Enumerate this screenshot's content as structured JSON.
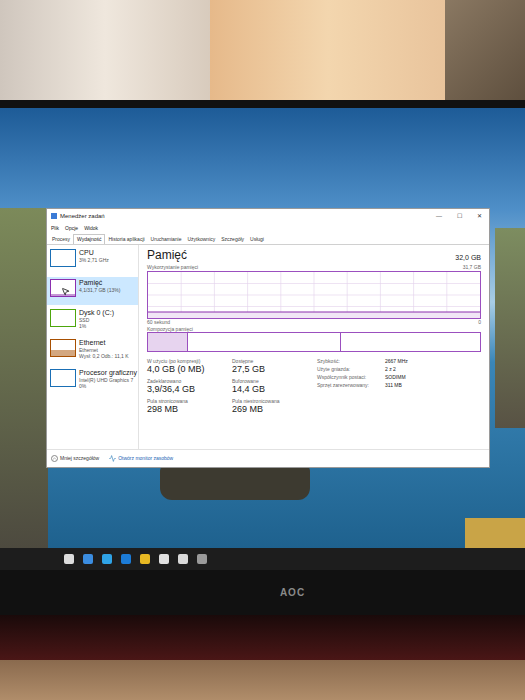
{
  "window": {
    "title": "Menedżer zadań",
    "controls": [
      "—",
      "☐",
      "✕"
    ]
  },
  "menu": [
    "Plik",
    "Opcje",
    "Widok"
  ],
  "tabs": [
    {
      "label": "Procesy",
      "selected": false
    },
    {
      "label": "Wydajność",
      "selected": true
    },
    {
      "label": "Historia aplikacji",
      "selected": false
    },
    {
      "label": "Uruchamianie",
      "selected": false
    },
    {
      "label": "Użytkownicy",
      "selected": false
    },
    {
      "label": "Szczegóły",
      "selected": false
    },
    {
      "label": "Usługi",
      "selected": false
    }
  ],
  "sidebar": {
    "items": [
      {
        "name": "CPU",
        "details": [
          "3% 2,71 GHz"
        ],
        "level": 0.03,
        "color": "#1a6fb5",
        "selected": false
      },
      {
        "name": "Pamięć",
        "details": [
          "4,1/31,7 GB (13%)"
        ],
        "level": 0.13,
        "color": "#8b2fae",
        "selected": true
      },
      {
        "name": "Dysk 0 (C:)",
        "details": [
          "SSD",
          "1%"
        ],
        "level": 0.01,
        "color": "#4da60c",
        "selected": false
      },
      {
        "name": "Ethernet",
        "details": [
          "Ethernet",
          "Wysł: 0,2 Odb.: 11,1 K"
        ],
        "level": 0.35,
        "color": "#a74f01",
        "selected": false
      },
      {
        "name": "Procesor graficzny",
        "details": [
          "Intel(R) UHD Graphics 7",
          "0%"
        ],
        "level": 0,
        "color": "#1a6fb5",
        "selected": false
      }
    ]
  },
  "main": {
    "title": "Pamięć",
    "total": "32,0 GB",
    "usage_label": "Wykorzystanie pamięci",
    "usage_max": "31,7 GB",
    "usage_history": [
      13,
      13,
      13,
      13,
      13,
      13,
      13,
      13,
      13,
      13,
      13,
      13,
      13,
      13,
      13,
      13
    ],
    "axis_left": "60 sekund",
    "axis_right": "0",
    "composition_label": "Kompozycja pamięci",
    "composition_in_use": 0.12,
    "composition_standby": 0.46,
    "stats": [
      {
        "label": "W użyciu (po kompresji)",
        "value": "4,0 GB (0 MB)"
      },
      {
        "label": "Dostępne",
        "value": "27,5 GB"
      },
      {
        "label": "Zadeklarowano",
        "value": "3,9/36,4 GB"
      },
      {
        "label": "Buforowane",
        "value": "14,4 GB"
      },
      {
        "label": "Pula stronicowana",
        "value": "298 MB"
      },
      {
        "label": "Pula niestronicowana",
        "value": "269 MB"
      }
    ],
    "specs": [
      {
        "label": "Szybkość:",
        "value": "2667 MHz"
      },
      {
        "label": "Użyte gniazda:",
        "value": "2 z 2"
      },
      {
        "label": "Współczynnik postaci:",
        "value": "SODIMM"
      },
      {
        "label": "Sprzęt zarezerwowany:",
        "value": "311 MB"
      }
    ]
  },
  "footer": {
    "less": "Mniej szczegółów",
    "monitor": "Otwórz monitor zasobów"
  },
  "monitor": {
    "brand": "AOC"
  }
}
